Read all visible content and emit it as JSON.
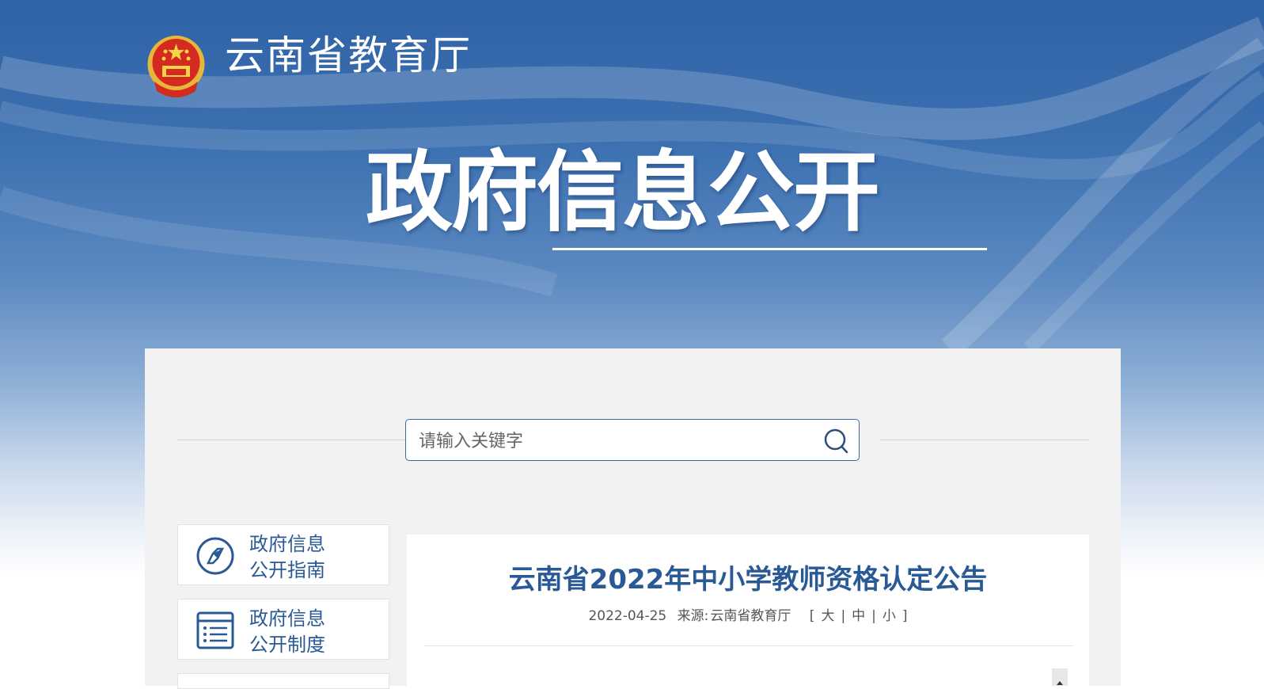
{
  "header": {
    "site_name": "云南省教育厅",
    "hero_title": "政府信息公开",
    "emblem_icon": "national-emblem-icon"
  },
  "search": {
    "placeholder": "请输入关键字",
    "icon": "search-icon"
  },
  "sidebar": {
    "items": [
      {
        "label_line1": "政府信息",
        "label_line2": "公开指南",
        "icon": "compass-icon"
      },
      {
        "label_line1": "政府信息",
        "label_line2": "公开制度",
        "icon": "document-list-icon"
      }
    ]
  },
  "article": {
    "title": "云南省2022年中小学教师资格认定公告",
    "date": "2022-04-25",
    "source_label": "来源:",
    "source": "云南省教育厅",
    "font_size_open": "[",
    "font_large": "大",
    "font_medium": "中",
    "font_small": "小",
    "font_size_close": "]",
    "sep": "|"
  },
  "colors": {
    "brand_blue": "#2a5a95",
    "banner_top": "#2f63a6",
    "panel_bg": "#f2f2f2"
  }
}
